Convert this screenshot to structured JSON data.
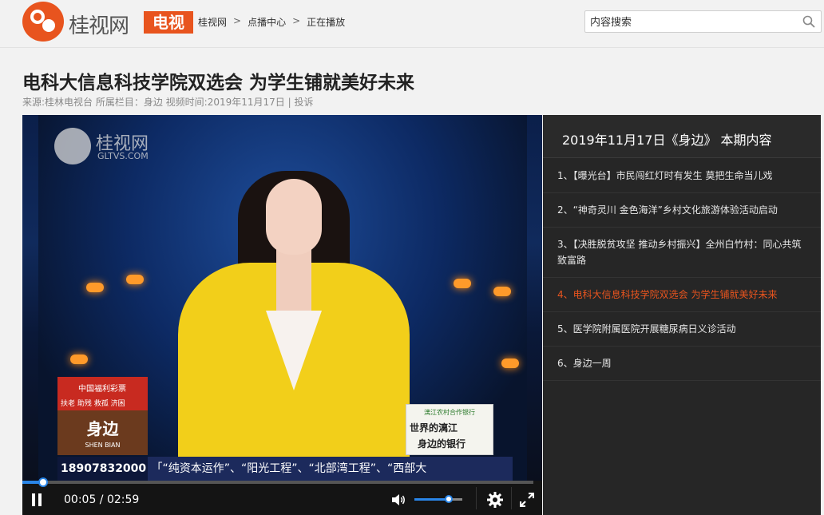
{
  "header": {
    "logo_text": "桂视网",
    "logo_badge": "电视",
    "breadcrumb": [
      "桂视网",
      "点播中心",
      "正在播放"
    ],
    "breadcrumb_sep": ">",
    "search_placeholder": "内容搜索"
  },
  "article": {
    "title": "电科大信息科技学院双选会 为学生铺就美好未来",
    "meta": "来源:桂林电视台 所属栏目：身边 视频时间:2019年11月17日 | 投诉"
  },
  "video": {
    "watermark_title": "桂视网",
    "watermark_url": "GLTVS.COM",
    "ad_left_brand": "中国福利彩票",
    "ad_left_slogan": "扶老 助残 救孤 济困",
    "ad_left_show": "身边",
    "ad_left_show_pinyin": "SHEN BIAN",
    "ad_right_bank": "漓江农村合作银行",
    "ad_right_line1": "世界的漓江",
    "ad_right_line2": "身边的银行",
    "ticker_phone": "18907832000",
    "ticker_text": "「“纯资本运作”、“阳光工程”、“北部湾工程”、“西部大"
  },
  "player": {
    "current_time": "00:05",
    "time_sep": " / ",
    "duration": "02:59",
    "progress_fraction": 0.04,
    "volume_fraction": 0.72,
    "icons": [
      "pause-icon",
      "volume-icon",
      "gear-icon",
      "fullscreen-icon"
    ]
  },
  "playlist": {
    "title": "2019年11月17日《身边》 本期内容",
    "items": [
      "1、【曝光台】市民闯红灯时有发生 莫把生命当儿戏",
      "2、“神奇灵川 金色海洋”乡村文化旅游体验活动启动",
      "3、【决胜脱贫攻坚 推动乡村振兴】全州白竹村：同心共筑致富路",
      "4、电科大信息科技学院双选会 为学生铺就美好未来",
      "5、医学院附属医院开展糖尿病日义诊活动",
      "6、身边一周"
    ],
    "active_index": 3
  },
  "colors": {
    "accent": "#e8541e",
    "progress": "#2a86e8"
  }
}
